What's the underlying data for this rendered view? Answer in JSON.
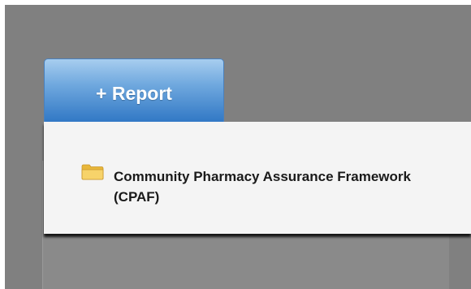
{
  "report_tab": {
    "label": "+ Report"
  },
  "dropdown": {
    "items": [
      {
        "icon": "folder-icon",
        "label": "Community Pharmacy Assurance Framework (CPAF)"
      }
    ]
  },
  "colors": {
    "tab_top": "#a7cdef",
    "tab_bottom": "#2f76c4",
    "dropdown_bg": "#f4f4f4",
    "overlay": "#808080",
    "folder_yellow": "#f0c64a"
  }
}
